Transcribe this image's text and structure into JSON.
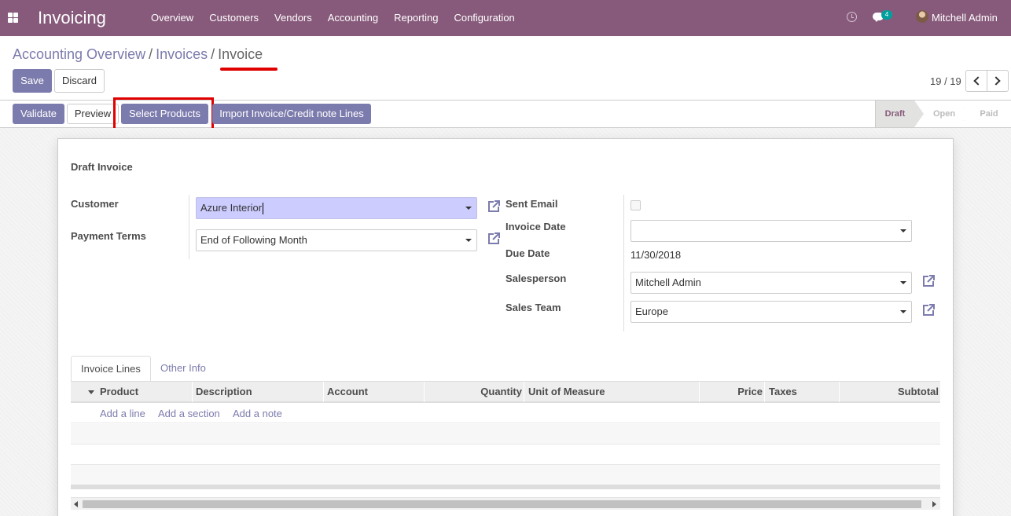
{
  "app": {
    "title": "Invoicing"
  },
  "menu": {
    "items": [
      "Overview",
      "Customers",
      "Vendors",
      "Accounting",
      "Reporting",
      "Configuration"
    ]
  },
  "systray": {
    "messages_count": "4",
    "user_name": "Mitchell Admin"
  },
  "breadcrumb": {
    "items": [
      "Accounting Overview",
      "Invoices"
    ],
    "current": "Invoice",
    "separator": "/"
  },
  "actions": {
    "save": "Save",
    "discard": "Discard"
  },
  "pager": {
    "value": "19 / 19"
  },
  "statusbar": {
    "buttons": {
      "validate": "Validate",
      "preview": "Preview",
      "select_products": "Select Products",
      "import_lines": "Import Invoice/Credit note Lines"
    },
    "stages": [
      "Draft",
      "Open",
      "Paid"
    ],
    "active_stage": "Draft"
  },
  "form": {
    "heading": "Draft Invoice",
    "customer": {
      "label": "Customer",
      "value": "Azure Interior"
    },
    "payment_terms": {
      "label": "Payment Terms",
      "value": "End of Following Month"
    },
    "sent_email": {
      "label": "Sent Email",
      "checked": false
    },
    "invoice_date": {
      "label": "Invoice Date",
      "value": ""
    },
    "due_date": {
      "label": "Due Date",
      "value": "11/30/2018"
    },
    "salesperson": {
      "label": "Salesperson",
      "value": "Mitchell Admin"
    },
    "sales_team": {
      "label": "Sales Team",
      "value": "Europe"
    }
  },
  "notebook": {
    "tabs": [
      "Invoice Lines",
      "Other Info"
    ],
    "active_tab": "Invoice Lines",
    "columns": [
      "Product",
      "Description",
      "Account",
      "Quantity",
      "Unit of Measure",
      "Price",
      "Taxes",
      "Subtotal"
    ],
    "add_links": [
      "Add a line",
      "Add a section",
      "Add a note"
    ]
  },
  "colors": {
    "brand": "#875a7b",
    "primary": "#7c7bad",
    "highlight": "#e00000",
    "focused_field": "#ccccff"
  }
}
